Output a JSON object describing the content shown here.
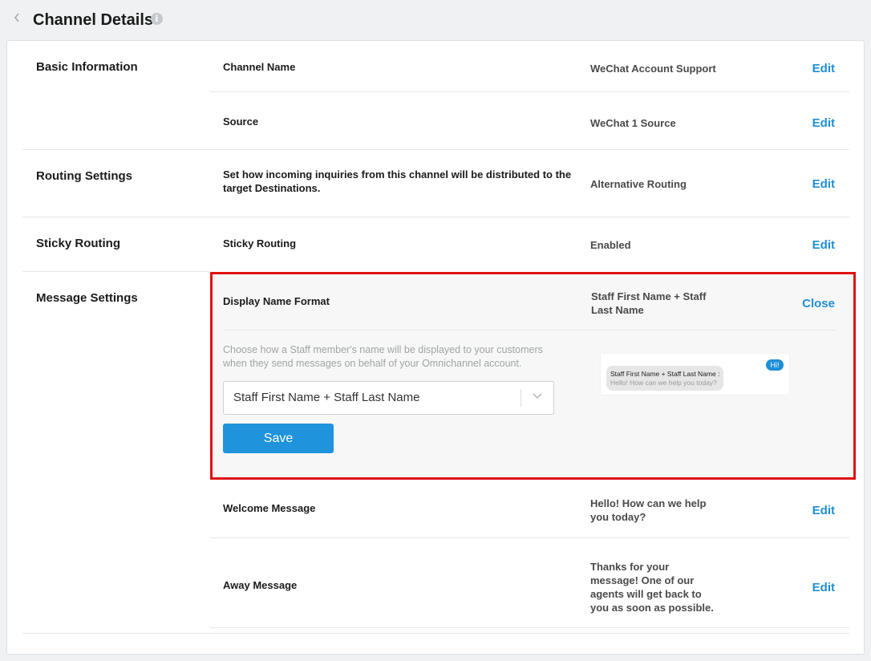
{
  "header": {
    "back_icon": "chevron-left-icon",
    "title": "Channel Details",
    "info_icon": "info-icon"
  },
  "sections": {
    "basic": {
      "title": "Basic Information",
      "rows": [
        {
          "label": "Channel Name",
          "value": "WeChat Account Support",
          "action": "Edit"
        },
        {
          "label": "Source",
          "value": "WeChat 1 Source",
          "action": "Edit"
        }
      ]
    },
    "routing": {
      "title": "Routing Settings",
      "label": "Set how incoming inquiries from this channel will be distributed to the target Destinations.",
      "value": "Alternative Routing",
      "action": "Edit"
    },
    "sticky": {
      "title": "Sticky Routing",
      "label": "Sticky Routing",
      "value": "Enabled",
      "action": "Edit"
    },
    "message": {
      "title": "Message Settings",
      "display_name": {
        "label": "Display Name Format",
        "value": "Staff First Name + Staff Last Name",
        "action": "Close",
        "help": "Choose how a Staff member's name will be displayed to your customers when they send messages on behalf of your Omnichannel account.",
        "select_value": "Staff First Name + Staff Last Name",
        "save_label": "Save",
        "preview": {
          "badge": "Hi!",
          "name": "Staff First Name + Staff Last Name :",
          "message": "Hello! How can we help you today?"
        }
      },
      "welcome": {
        "label": "Welcome Message",
        "value": "Hello! How can we help you today?",
        "action": "Edit"
      },
      "away": {
        "label": "Away Message",
        "value": "Thanks for your message! One of our agents will get back to you as soon as possible.",
        "action": "Edit"
      }
    }
  },
  "colors": {
    "accent": "#1e8fd7",
    "highlight_border": "#e01212",
    "background": "#eff1f2"
  }
}
